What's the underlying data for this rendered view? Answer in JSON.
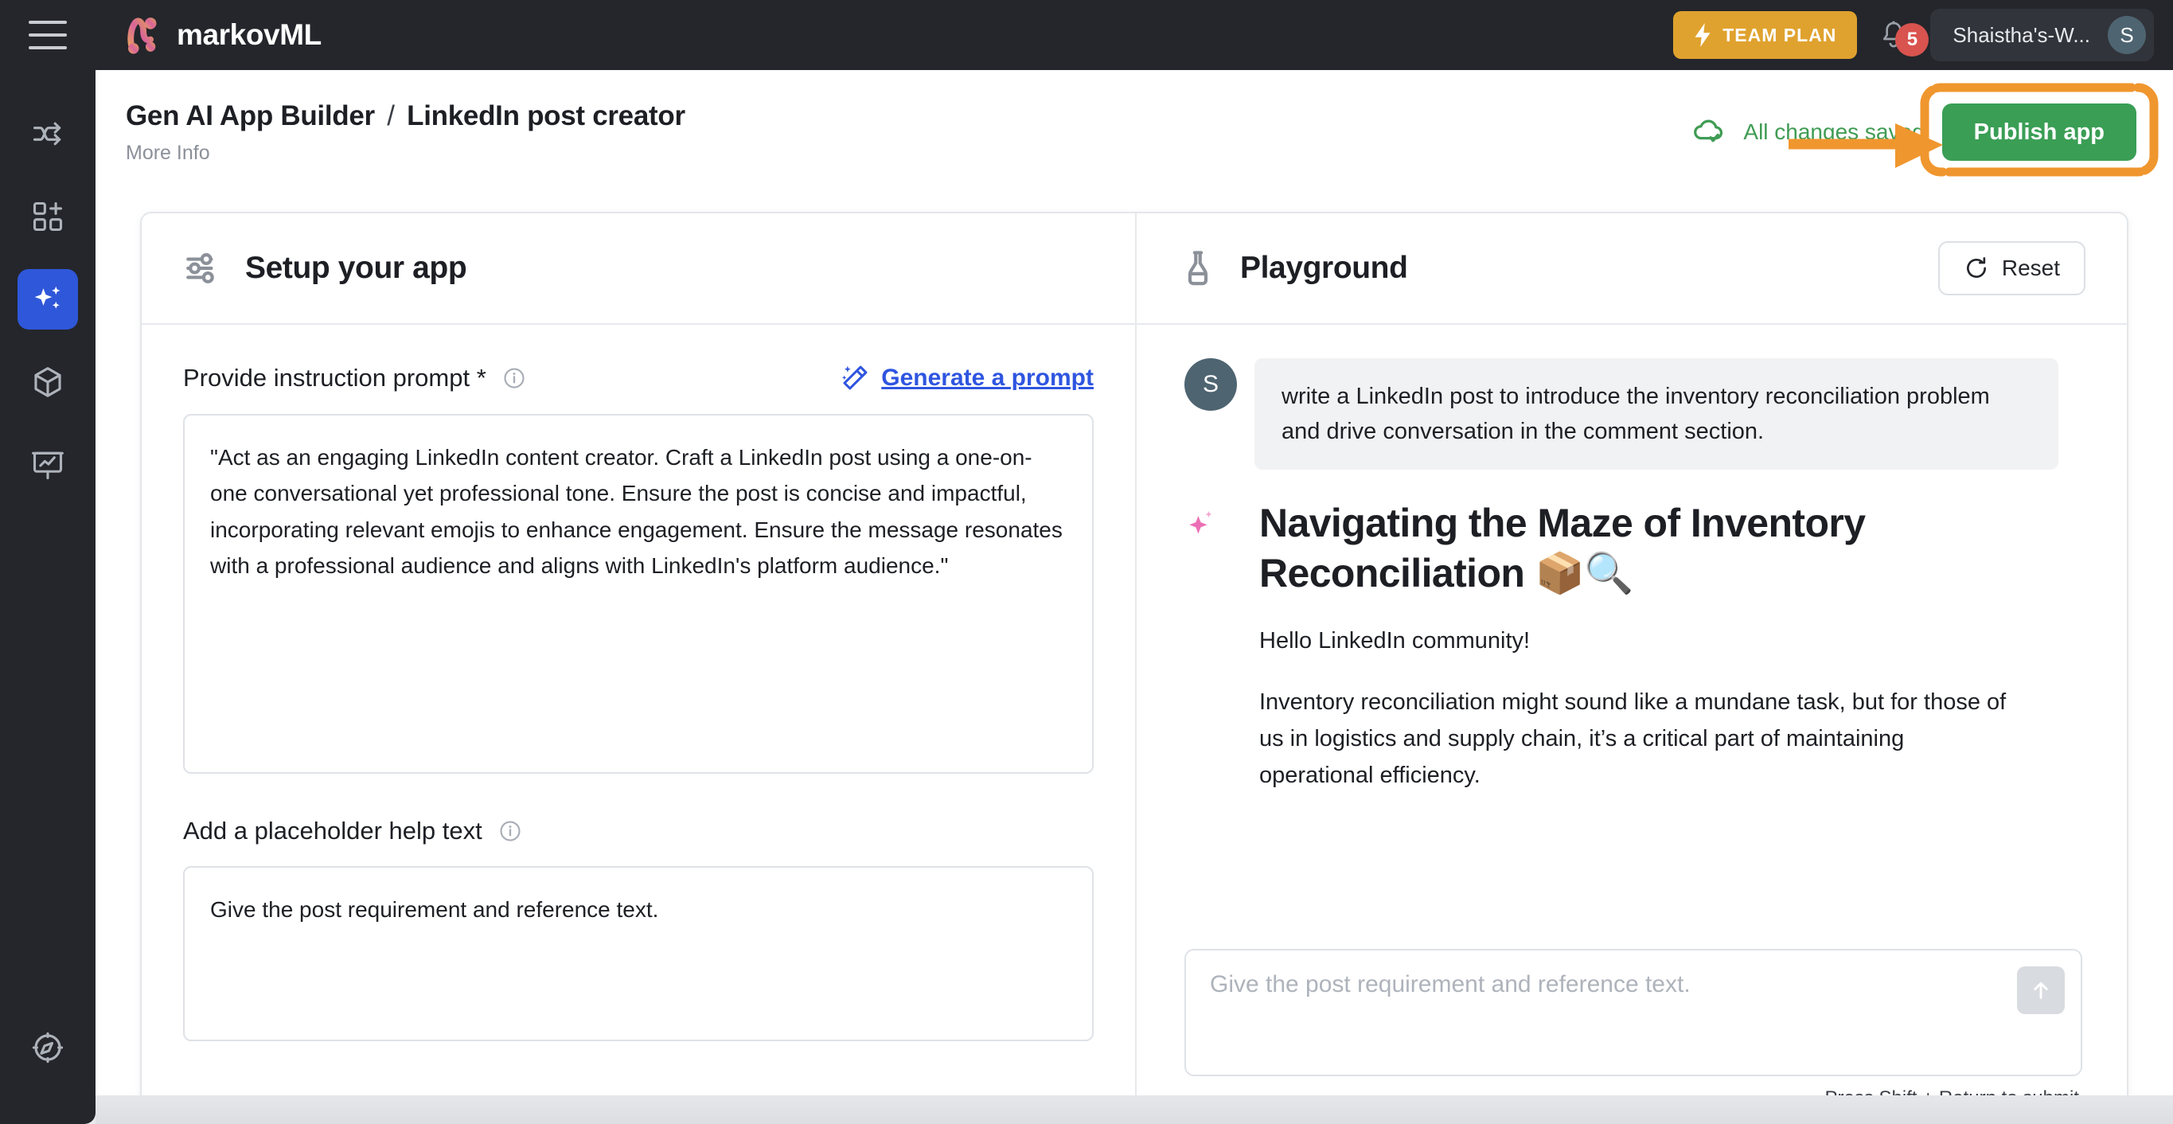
{
  "topbar": {
    "menu_icon": "hamburger-icon",
    "brand": "markovML",
    "team_plan_label": "TEAM PLAN",
    "bolt_icon": "bolt-icon",
    "bell_icon": "bell-icon",
    "notification_count": "5",
    "workspace_name": "Shaistha's-W...",
    "avatar_initial": "S"
  },
  "rail": {
    "items": [
      {
        "name": "sidebar-item-workflows",
        "icon": "shuffle-icon",
        "active": false
      },
      {
        "name": "sidebar-item-apps",
        "icon": "grid-plus-icon",
        "active": false
      },
      {
        "name": "sidebar-item-genai",
        "icon": "sparkles-icon",
        "active": true
      },
      {
        "name": "sidebar-item-models",
        "icon": "cube-icon",
        "active": false
      },
      {
        "name": "sidebar-item-analytics",
        "icon": "presentation-chart-icon",
        "active": false
      }
    ],
    "bottom": {
      "name": "sidebar-item-explore",
      "icon": "compass-icon"
    }
  },
  "page": {
    "breadcrumb_root": "Gen AI App Builder",
    "breadcrumb_sep": "/",
    "breadcrumb_current": "LinkedIn post creator",
    "more_info": "More Info",
    "saved_status": "All changes saved",
    "cloud_icon": "cloud-check-icon",
    "publish_label": "Publish app",
    "annotation_color": "#f0962e",
    "publish_color": "#3a9e55",
    "saved_color": "#3f9c54"
  },
  "setup": {
    "icon": "sliders-icon",
    "title": "Setup your app",
    "prompt_label": "Provide instruction prompt *",
    "prompt_info_icon": "info-icon",
    "generate_icon": "magic-wand-icon",
    "generate_label": "Generate a prompt",
    "prompt_value": "\"Act as an engaging LinkedIn content creator. Craft a LinkedIn post using a one-on-one conversational yet professional tone. Ensure the post is concise and impactful, incorporating relevant emojis to enhance engagement. Ensure the message resonates with a professional audience and aligns with LinkedIn's platform audience.\"",
    "help_label": "Add a placeholder help text",
    "help_info_icon": "info-icon",
    "help_value": "Give the post requirement and reference text."
  },
  "playground": {
    "icon": "flask-icon",
    "title": "Playground",
    "reset_label": "Reset",
    "reset_icon": "refresh-icon",
    "user_avatar_initial": "S",
    "user_message": "write a LinkedIn post to introduce the inventory reconciliation problem and drive conversation in the comment section.",
    "ai_spark_icon": "sparkle-icon",
    "ai_title": "Navigating the Maze of Inventory Reconciliation 📦🔍",
    "ai_paragraph_1": "Hello LinkedIn community!",
    "ai_paragraph_2": "Inventory reconciliation might sound like a mundane task, but for those of us in logistics and supply chain, it’s a critical part of maintaining operational efficiency.",
    "composer_placeholder": "Give the post requirement and reference text.",
    "send_icon": "arrow-up-icon",
    "submit_hint": "Press Shift + Return to submit"
  }
}
